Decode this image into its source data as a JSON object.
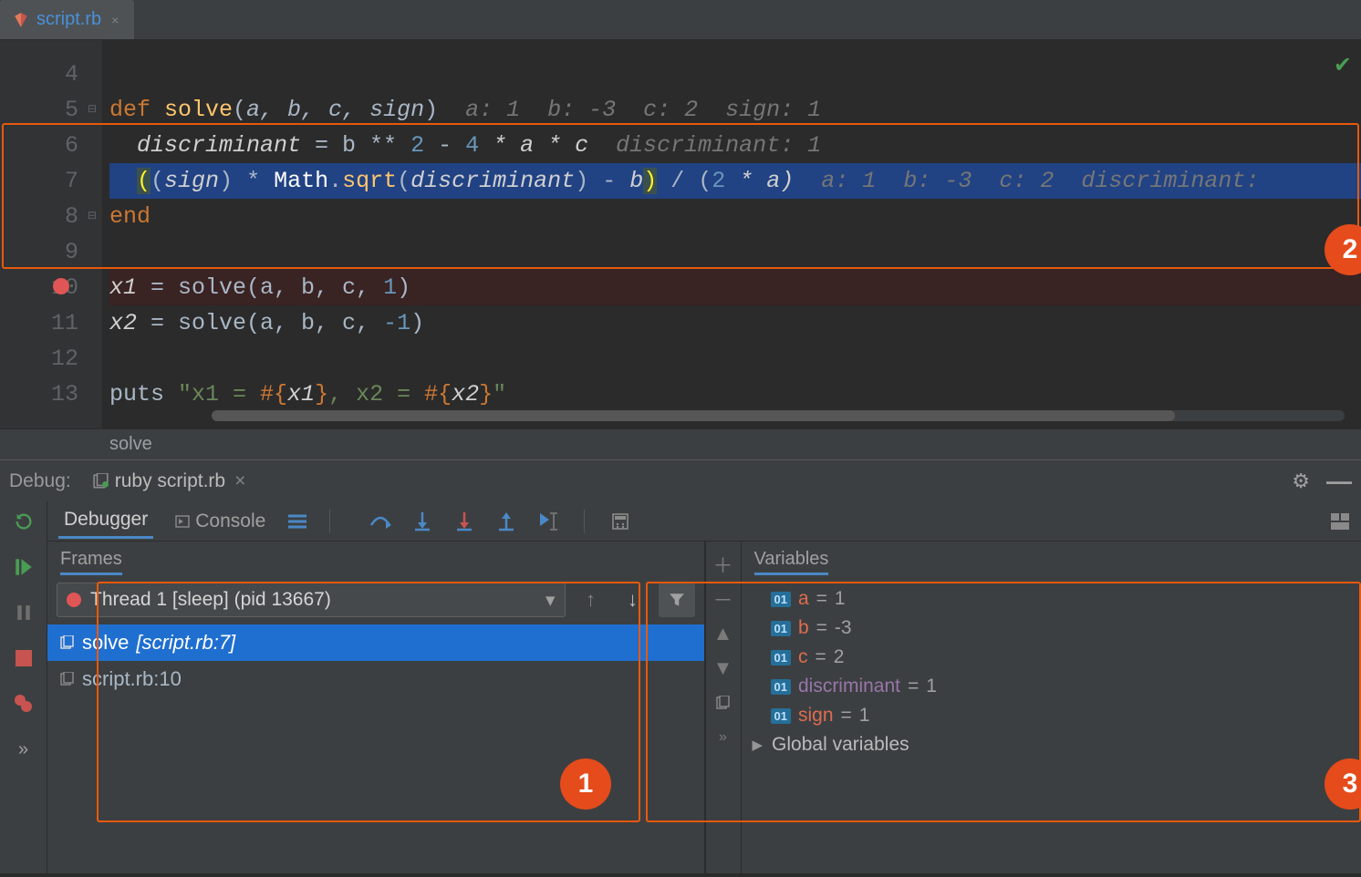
{
  "tab": {
    "filename": "script.rb",
    "close_glyph": "×"
  },
  "lines": [
    "4",
    "5",
    "6",
    "7",
    "8",
    "9",
    "10",
    "11",
    "12",
    "13"
  ],
  "code": {
    "l5": {
      "def": "def ",
      "fn": "solve",
      "open": "(",
      "p": "a, b, c, sign",
      "close": ")",
      "hint": "  a: 1  b: -3  c: 2  sign: 1"
    },
    "l6": {
      "indent": "  ",
      "v": "discriminant",
      "rest": " = b ** ",
      "n2": "2",
      "m": " - ",
      "n4": "4",
      "r": " * a * c",
      "hint": "  discriminant: 1"
    },
    "l7": {
      "indent": "  ",
      "p1": "(",
      "p2": "(",
      "sign": "sign",
      "cp": ")",
      "star": " * ",
      "math": "Math",
      "dot": ".",
      "sqrt": "sqrt",
      "op": "(",
      "disc": "discriminant",
      "cp2": ")",
      "minus": " - ",
      "b": "b",
      "cp3": ")",
      "rest": " / (",
      "two": "2",
      "sa": " * a)",
      "hint": "  a: 1  b: -3  c: 2  discriminant:"
    },
    "l8": {
      "end": "end"
    },
    "l10": {
      "v": "x1",
      "eq": " = solve(a, b, c, ",
      "n": "1",
      "cp": ")"
    },
    "l11": {
      "v": "x2",
      "eq": " = solve(a, b, c, ",
      "n": "-1",
      "cp": ")"
    },
    "l13": {
      "puts": "puts ",
      "s1": "\"x1 = ",
      "i1o": "#{",
      "i1v": "x1",
      "i1c": "}",
      "mid": ", x2 = ",
      "i2o": "#{",
      "i2v": "x2",
      "i2c": "}",
      "s2": "\""
    }
  },
  "breadcrumb": "solve",
  "debug": {
    "label": "Debug:",
    "config": "ruby script.rb",
    "close_glyph": "×",
    "tabs": {
      "debugger": "Debugger",
      "console": "Console"
    },
    "frames": {
      "title": "Frames",
      "thread": "Thread 1 [sleep] (pid 13667)",
      "items": [
        {
          "name": "solve",
          "loc": "[script.rb:7]"
        },
        {
          "name": "script.rb:10",
          "loc": ""
        }
      ]
    },
    "variables": {
      "title": "Variables",
      "items": [
        {
          "name": "a",
          "val": "1"
        },
        {
          "name": "b",
          "val": "-3"
        },
        {
          "name": "c",
          "val": "2"
        },
        {
          "name": "discriminant",
          "val": "1",
          "purple": true
        },
        {
          "name": "sign",
          "val": "1"
        }
      ],
      "global": "Global variables"
    }
  },
  "badges": {
    "1": "1",
    "2": "2",
    "3": "3"
  }
}
